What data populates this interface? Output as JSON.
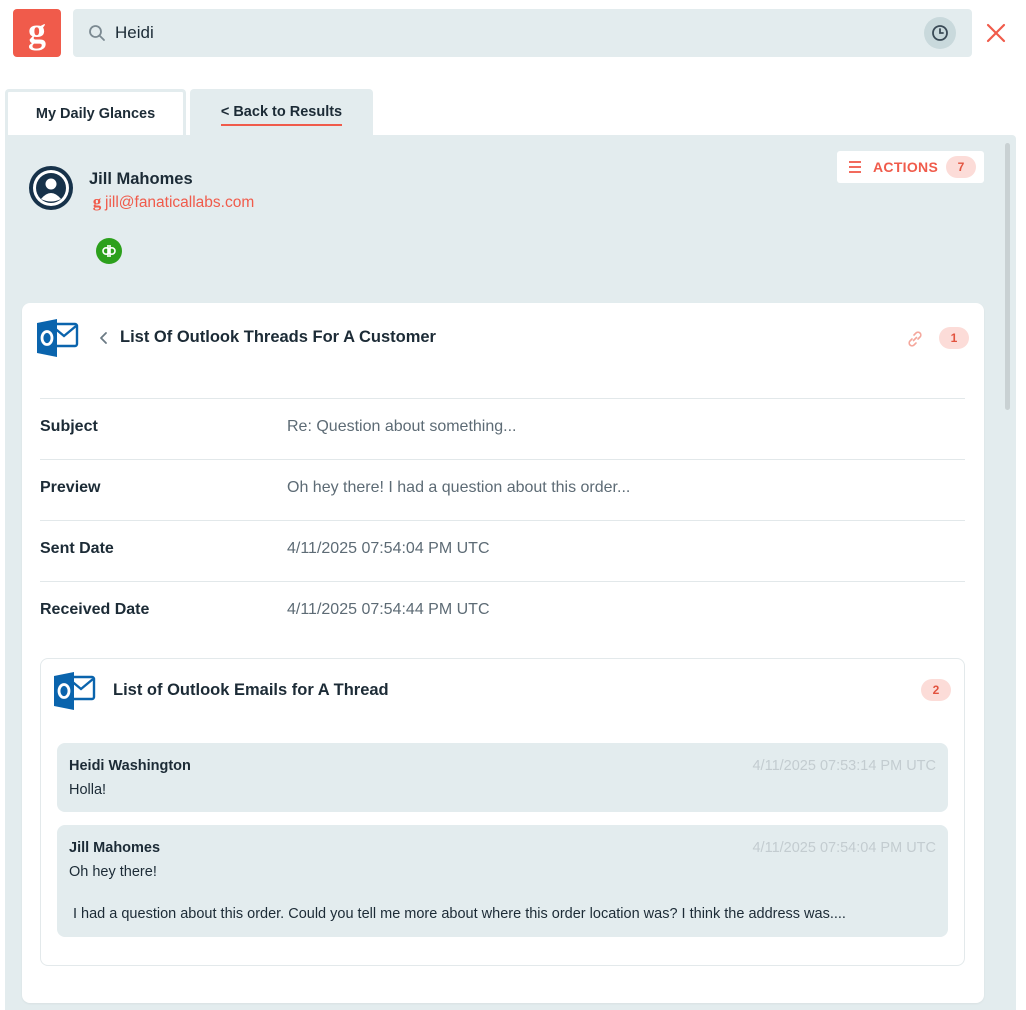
{
  "search": {
    "value": "Heidi",
    "placeholder": "Search"
  },
  "tabs": {
    "glances_label": "My Daily Glances",
    "back_label": "< Back to Results"
  },
  "contact": {
    "name": "Jill Mahomes",
    "email": "jill@fanaticallabs.com"
  },
  "actions": {
    "label": "ACTIONS",
    "count": "7"
  },
  "thread_card": {
    "title": "List Of Outlook Threads For A Customer",
    "count": "1",
    "fields": [
      {
        "label": "Subject",
        "value": "Re: Question about something..."
      },
      {
        "label": "Preview",
        "value": "Oh hey there! I had a question about this order..."
      },
      {
        "label": "Sent Date",
        "value": "4/11/2025 07:54:04 PM UTC"
      },
      {
        "label": "Received Date",
        "value": "4/11/2025 07:54:44 PM UTC"
      }
    ]
  },
  "emails_card": {
    "title": "List of Outlook Emails for A Thread",
    "count": "2",
    "messages": [
      {
        "from": "Heidi Washington",
        "time": "4/11/2025 07:53:14 PM UTC",
        "body": "Holla!"
      },
      {
        "from": "Jill Mahomes",
        "time": "4/11/2025 07:54:04 PM UTC",
        "body": "Oh hey there!",
        "body2": "I had a question about this order. Could you tell me more about where this order location was? I think the address was...."
      }
    ]
  },
  "colors": {
    "brand": "#f05b4b",
    "panel": "#e3ecee",
    "dark": "#1c2b36",
    "quickbooks": "#2ca01c",
    "outlook": "#0a64ad"
  },
  "icons": [
    "g-logo-icon",
    "search-icon",
    "history-icon",
    "close-icon",
    "avatar-icon",
    "g-brand-icon",
    "quickbooks-icon",
    "hamburger-icon",
    "outlook-icon",
    "chevron-left-icon",
    "link-icon"
  ]
}
